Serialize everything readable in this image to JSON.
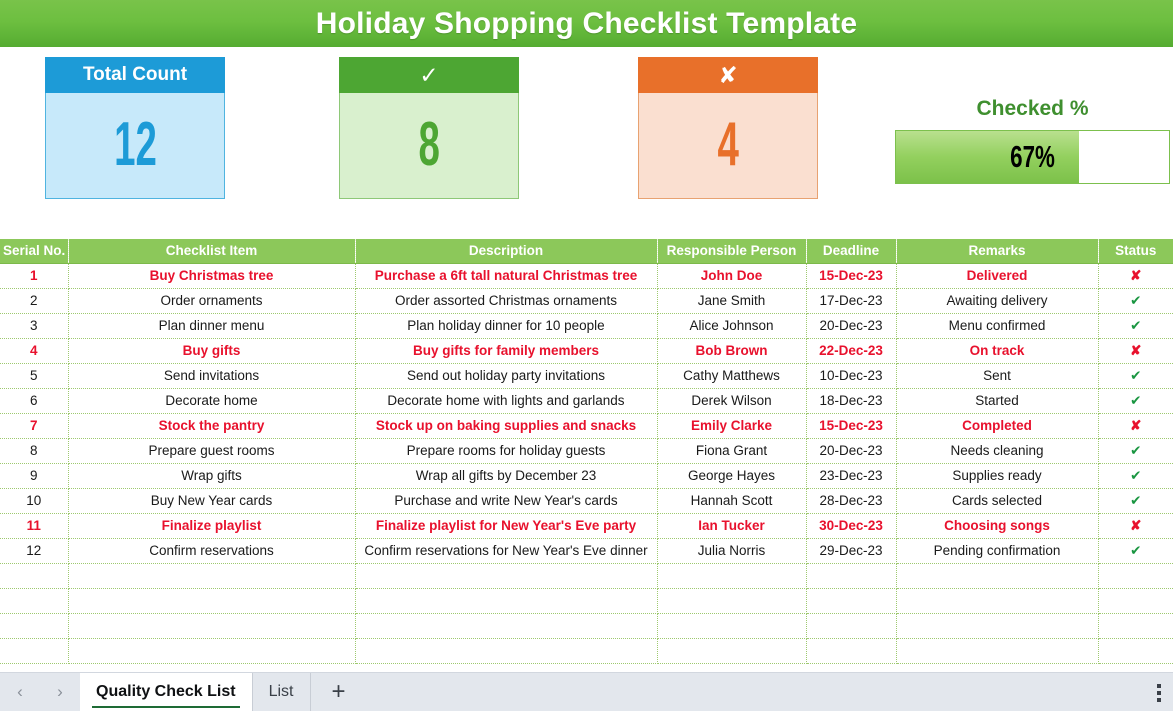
{
  "header": {
    "title": "Holiday Shopping Checklist Template",
    "banner_color": "#6dbf40"
  },
  "kpi": {
    "total": {
      "label": "Total Count",
      "value": "12",
      "head_color": "#1d9bd7",
      "body_color": "#c7e9fa"
    },
    "checked": {
      "label": "✓",
      "value": "8",
      "head_color": "#4da633",
      "body_color": "#d9f0ce"
    },
    "unchecked": {
      "label": "✘",
      "value": "4",
      "head_color": "#e8702a",
      "body_color": "#fadfd0"
    },
    "progress": {
      "label": "Checked %",
      "value": "67%",
      "percent": 67,
      "fill_color": "#93d05e",
      "label_color": "#3f8f2f"
    }
  },
  "table": {
    "columns": [
      "Serial No.",
      "Checklist Item",
      "Description",
      "Responsible Person",
      "Deadline",
      "Remarks",
      "Status"
    ],
    "header_color": "#8cc85a",
    "flag_color": "#e8112d",
    "check_glyph": "✔",
    "cross_glyph": "✘",
    "empty_row_count": 4,
    "rows": [
      {
        "serial": "1",
        "item": "Buy Christmas tree",
        "description": "Purchase a 6ft tall natural Christmas tree",
        "person": "John Doe",
        "deadline": "15-Dec-23",
        "remarks": "Delivered",
        "status": "cross",
        "flagged": true
      },
      {
        "serial": "2",
        "item": "Order ornaments",
        "description": "Order assorted Christmas ornaments",
        "person": "Jane Smith",
        "deadline": "17-Dec-23",
        "remarks": "Awaiting delivery",
        "status": "check",
        "flagged": false
      },
      {
        "serial": "3",
        "item": "Plan dinner menu",
        "description": "Plan holiday dinner for 10 people",
        "person": "Alice Johnson",
        "deadline": "20-Dec-23",
        "remarks": "Menu confirmed",
        "status": "check",
        "flagged": false
      },
      {
        "serial": "4",
        "item": "Buy gifts",
        "description": "Buy gifts for family members",
        "person": "Bob Brown",
        "deadline": "22-Dec-23",
        "remarks": "On track",
        "status": "cross",
        "flagged": true
      },
      {
        "serial": "5",
        "item": "Send invitations",
        "description": "Send out holiday party invitations",
        "person": "Cathy Matthews",
        "deadline": "10-Dec-23",
        "remarks": "Sent",
        "status": "check",
        "flagged": false
      },
      {
        "serial": "6",
        "item": "Decorate home",
        "description": "Decorate home with lights and garlands",
        "person": "Derek Wilson",
        "deadline": "18-Dec-23",
        "remarks": "Started",
        "status": "check",
        "flagged": false
      },
      {
        "serial": "7",
        "item": "Stock the pantry",
        "description": "Stock up on baking supplies and snacks",
        "person": "Emily Clarke",
        "deadline": "15-Dec-23",
        "remarks": "Completed",
        "status": "cross",
        "flagged": true
      },
      {
        "serial": "8",
        "item": "Prepare guest rooms",
        "description": "Prepare rooms for holiday guests",
        "person": "Fiona Grant",
        "deadline": "20-Dec-23",
        "remarks": "Needs cleaning",
        "status": "check",
        "flagged": false
      },
      {
        "serial": "9",
        "item": "Wrap gifts",
        "description": "Wrap all gifts by December 23",
        "person": "George Hayes",
        "deadline": "23-Dec-23",
        "remarks": "Supplies ready",
        "status": "check",
        "flagged": false
      },
      {
        "serial": "10",
        "item": "Buy New Year cards",
        "description": "Purchase and write New Year's cards",
        "person": "Hannah Scott",
        "deadline": "28-Dec-23",
        "remarks": "Cards selected",
        "status": "check",
        "flagged": false
      },
      {
        "serial": "11",
        "item": "Finalize playlist",
        "description": "Finalize playlist for New Year's Eve party",
        "person": "Ian Tucker",
        "deadline": "30-Dec-23",
        "remarks": "Choosing songs",
        "status": "cross",
        "flagged": true
      },
      {
        "serial": "12",
        "item": "Confirm reservations",
        "description": "Confirm reservations for New Year's Eve dinner",
        "person": "Julia Norris",
        "deadline": "29-Dec-23",
        "remarks": "Pending confirmation",
        "status": "check",
        "flagged": false
      }
    ]
  },
  "tabbar": {
    "prev_glyph": "‹",
    "next_glyph": "›",
    "add_glyph": "+",
    "tabs": [
      {
        "label": "Quality Check List",
        "active": true
      },
      {
        "label": "List",
        "active": false
      }
    ]
  }
}
